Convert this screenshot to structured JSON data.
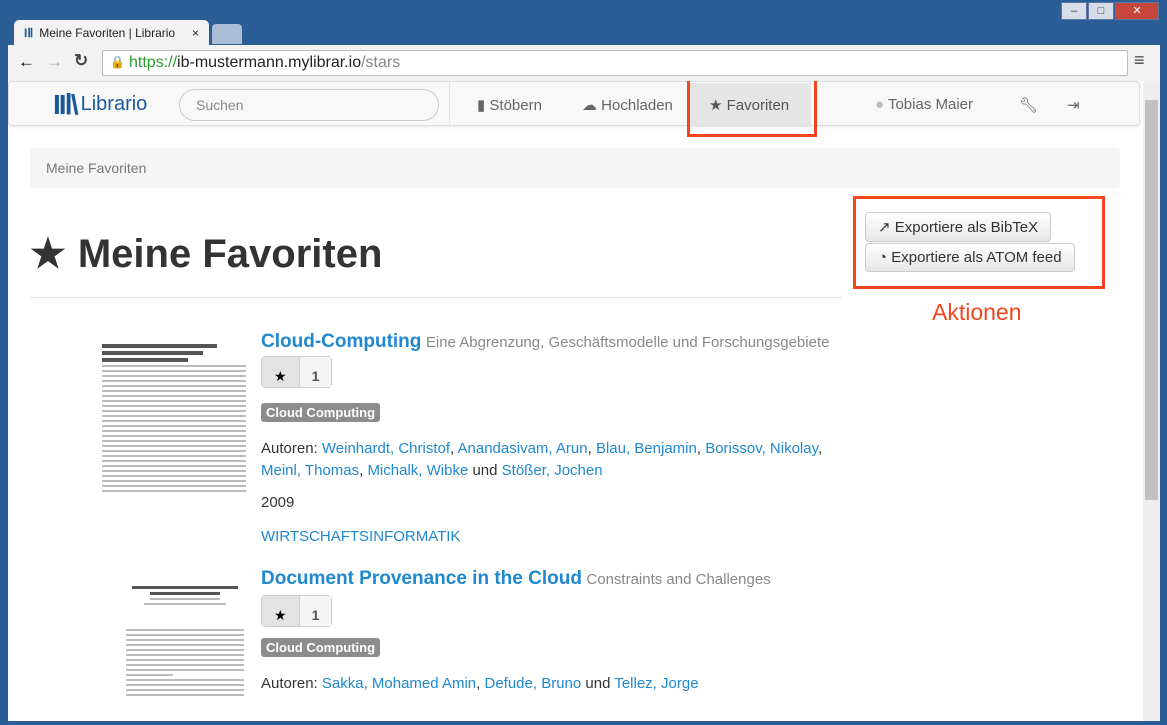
{
  "browser": {
    "tab_title": "Meine Favoriten | Librario",
    "url_scheme": "https://",
    "url_host": "ib-mustermann.mylibrar.io",
    "url_path": "/stars"
  },
  "navbar": {
    "brand": "Librario",
    "search_placeholder": "Suchen",
    "items": [
      {
        "label": "Stöbern",
        "icon": "book-icon"
      },
      {
        "label": "Hochladen",
        "icon": "cloud-upload-icon"
      },
      {
        "label": "Favoriten",
        "icon": "star-icon"
      }
    ],
    "user": "Tobias Maier"
  },
  "breadcrumb": "Meine Favoriten",
  "page_title": "Meine Favoriten",
  "actions": {
    "bibtex": "Exportiere als BibTeX",
    "atom": "Exportiere als ATOM feed",
    "annotation": "Aktionen"
  },
  "highlight_color": "#f2461f",
  "items": [
    {
      "title": "Cloud-Computing",
      "subtitle": "Eine Abgrenzung, Geschäftsmodelle und Forschungsgebiete",
      "stars": "1",
      "tag": "Cloud Computing",
      "authors_label": "Autoren:",
      "authors": [
        "Weinhardt, Christof",
        "Anandasivam, Arun",
        "Blau, Benjamin",
        "Borissov, Nikolay",
        "Meinl, Thomas",
        "Michalk, Wibke",
        "Stößer, Jochen"
      ],
      "and": "und",
      "year": "2009",
      "journal": "WIRTSCHAFTSINFORMATIK"
    },
    {
      "title": "Document Provenance in the Cloud",
      "subtitle": "Constraints and Challenges",
      "stars": "1",
      "tag": "Cloud Computing",
      "authors_label": "Autoren:",
      "authors": [
        "Sakka, Mohamed Amin",
        "Defude, Bruno",
        "Tellez, Jorge"
      ],
      "and": "und"
    }
  ]
}
